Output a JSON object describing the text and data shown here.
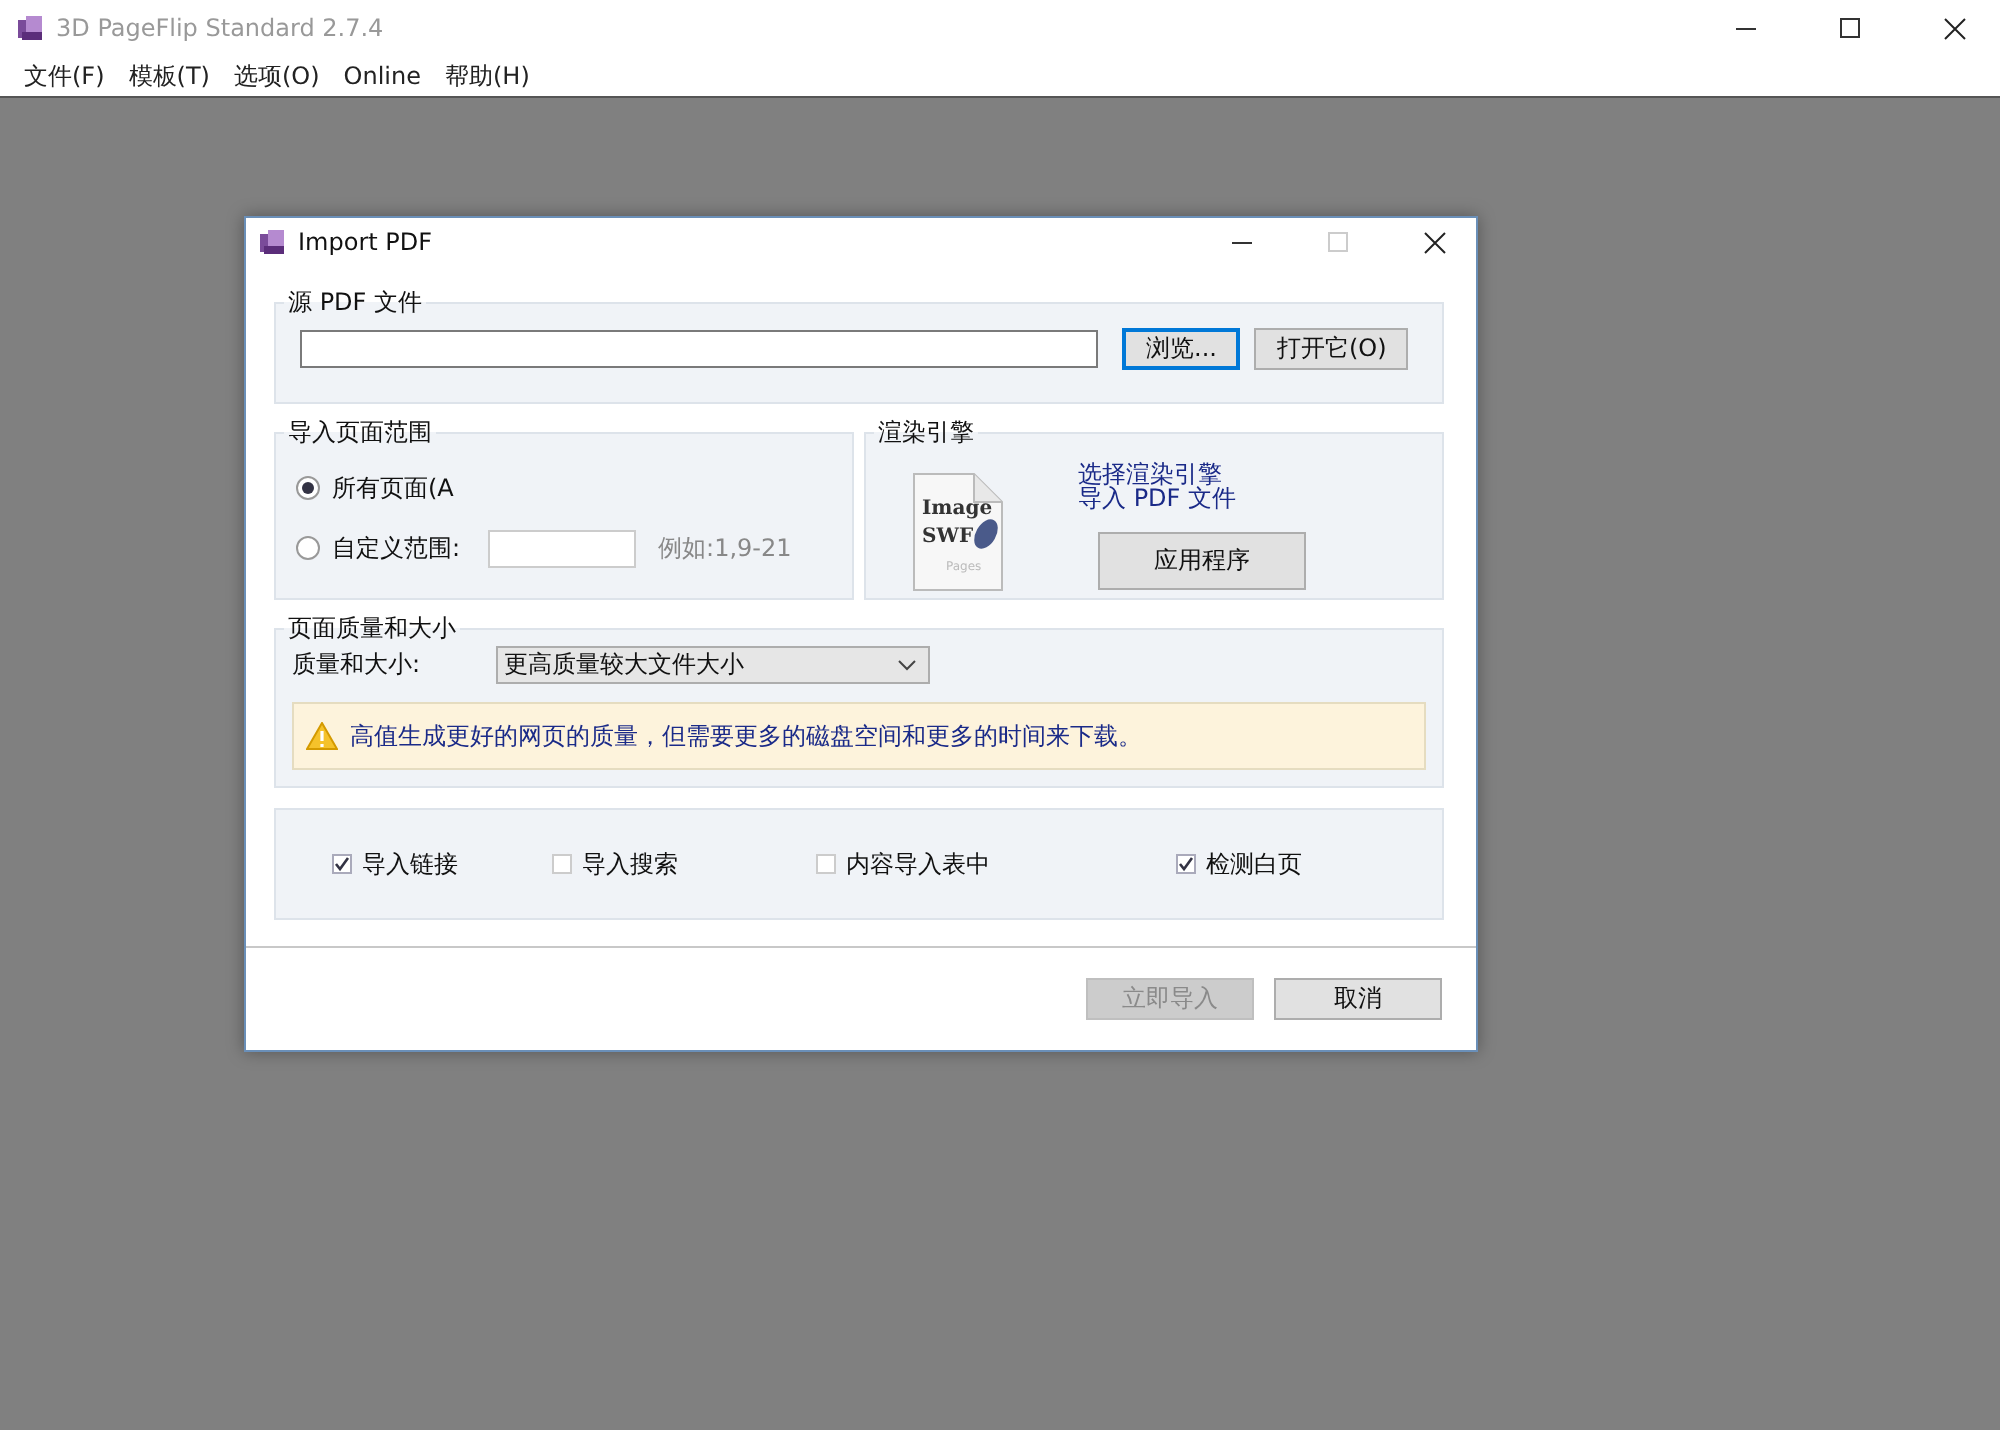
{
  "window": {
    "title": "3D PageFlip Standard 2.7.4"
  },
  "menu": [
    {
      "label": "文件(F)"
    },
    {
      "label": "模板(T)"
    },
    {
      "label": "选项(O)"
    },
    {
      "label": "Online"
    },
    {
      "label": "帮助(H)"
    }
  ],
  "dialog": {
    "title": "Import PDF",
    "source": {
      "legend": "源 PDF 文件",
      "buttons": [
        {
          "label": "浏览...",
          "focused": true
        },
        {
          "label": "打开它(O)",
          "focused": false
        }
      ]
    },
    "range": {
      "legend": "导入页面范围",
      "options": [
        {
          "label": "所有页面(A",
          "selected": true,
          "kind": "plain"
        },
        {
          "label": "自定义范围:",
          "selected": false,
          "kind": "range"
        }
      ],
      "example": "例如:1,9-21"
    },
    "engine": {
      "legend": "渲染引擎",
      "icon_texts": [
        "Image",
        "SWF",
        "Pages"
      ],
      "lines": [
        "选择渲染引擎",
        "导入 PDF 文件"
      ],
      "button": "应用程序"
    },
    "quality": {
      "legend": "页面质量和大小",
      "label": "质量和大小:",
      "value": "更高质量较大文件大小",
      "warning": "高值生成更好的网页的质量，但需要更多的磁盘空间和更多的时间来下载。"
    },
    "options": [
      {
        "label": "导入链接",
        "checked": true
      },
      {
        "label": "导入搜索",
        "checked": false
      },
      {
        "label": "内容导入表中",
        "checked": false
      },
      {
        "label": "检测白页",
        "checked": true
      }
    ],
    "footer": [
      {
        "label": "立即导入",
        "disabled": true
      },
      {
        "label": "取消",
        "disabled": false
      }
    ]
  }
}
